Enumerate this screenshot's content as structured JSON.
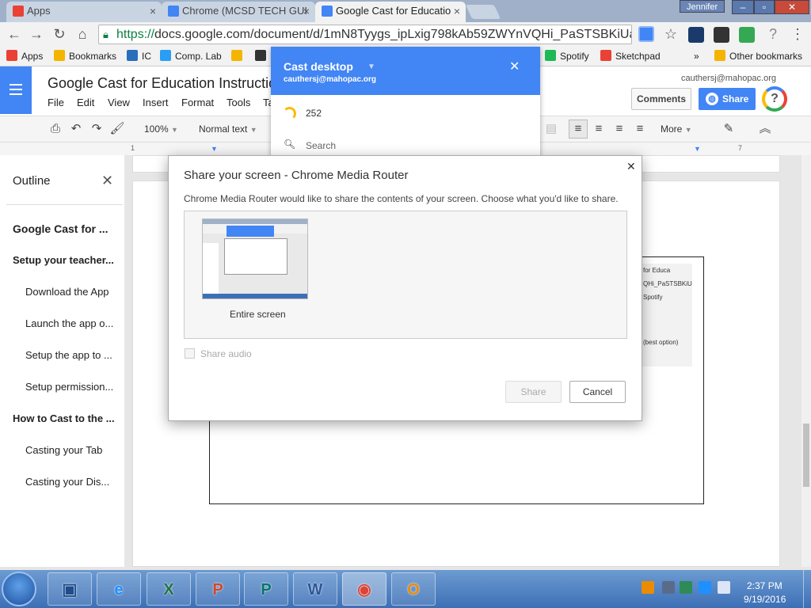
{
  "window": {
    "user": "Jennifer"
  },
  "tabs": [
    {
      "title": "Apps",
      "state": "inactive",
      "favicon_color": "#e94235"
    },
    {
      "title": "Chrome (MCSD TECH GUI",
      "state": "inactive",
      "favicon_color": "#4285f4"
    },
    {
      "title": "Google Cast for Educatio",
      "state": "active",
      "favicon_color": "#4285f4"
    }
  ],
  "toolbar": {
    "url_scheme": "https://",
    "url_rest": "docs.google.com/document/d/1mN8Tyygs_ipLxig798kAb59ZWYnVQHi_PaSTSBKiUa"
  },
  "bookmarks": [
    {
      "label": "Apps",
      "icon_color": "#e94235"
    },
    {
      "label": "Bookmarks",
      "icon_color": "#f4b400"
    },
    {
      "label": "IC",
      "icon_color": "#2a6ebb"
    },
    {
      "label": "Comp. Lab",
      "icon_color": "#2a9df4"
    },
    {
      "label": "",
      "icon_color": "#f4b400"
    },
    {
      "label": "",
      "icon_color": "#333333"
    },
    {
      "label": "Spotify",
      "icon_color": "#1db954"
    },
    {
      "label": "Sketchpad",
      "icon_color": "#e94235"
    },
    {
      "label": "»",
      "icon_color": ""
    },
    {
      "label": "Other bookmarks",
      "icon_color": "#f4b400"
    }
  ],
  "doc": {
    "title": "Google Cast for Education Instructio",
    "menus": [
      "File",
      "Edit",
      "View",
      "Insert",
      "Format",
      "Tools",
      "Ta"
    ],
    "account": "cauthersj@mahopac.org",
    "comments_label": "Comments",
    "share_label": "Share",
    "help_label": "?"
  },
  "format_bar": {
    "zoom": "100%",
    "style": "Normal text",
    "more_label": "More"
  },
  "ruler": {
    "left_mark": "1",
    "right_mark": "7"
  },
  "outline": {
    "title": "Outline",
    "items": [
      {
        "label": "Google Cast for ...",
        "level": 1
      },
      {
        "label": "Setup your teacher...",
        "level": 2
      },
      {
        "label": "Download the App",
        "level": 3
      },
      {
        "label": "Launch the app o...",
        "level": 3
      },
      {
        "label": "Setup the app to ...",
        "level": 3
      },
      {
        "label": "Setup permission...",
        "level": 3
      },
      {
        "label": "How to Cast to the ...",
        "level": 2
      },
      {
        "label": "Casting your Tab",
        "level": 3
      },
      {
        "label": "Casting your Dis...",
        "level": 3
      }
    ]
  },
  "cast_popup": {
    "title": "Cast desktop",
    "email": "cauthersj@mahopac.org",
    "item_count": "252",
    "search_placeholder": "Search"
  },
  "dialog": {
    "title": "Share your screen - Chrome Media Router",
    "description": "Chrome Media Router would like to share the contents of your screen. Choose what you'd like to share.",
    "source_label": "Entire screen",
    "share_audio_label": "Share audio",
    "share_audio_checked": false,
    "share_button": "Share",
    "share_enabled": false,
    "cancel_button": "Cancel"
  },
  "embedded_image_text": {
    "line1": "for Educa",
    "line2": "QHi_PaSTSBKiU",
    "line3": "Spotify",
    "line4": "(best option)"
  },
  "taskbar": {
    "apps": [
      {
        "name": "remote-desktop",
        "glyph": "▣",
        "color": "#1f4d8c"
      },
      {
        "name": "internet-explorer",
        "glyph": "e",
        "color": "#1e90ff"
      },
      {
        "name": "excel",
        "glyph": "X",
        "color": "#217346"
      },
      {
        "name": "powerpoint",
        "glyph": "P",
        "color": "#d24726"
      },
      {
        "name": "publisher",
        "glyph": "P",
        "color": "#077568"
      },
      {
        "name": "word",
        "glyph": "W",
        "color": "#2b579a"
      },
      {
        "name": "chrome",
        "glyph": "◉",
        "color": "#db4437"
      },
      {
        "name": "outlook",
        "glyph": "O",
        "color": "#ea8c00"
      }
    ],
    "time": "2:37 PM",
    "date": "9/19/2016"
  }
}
